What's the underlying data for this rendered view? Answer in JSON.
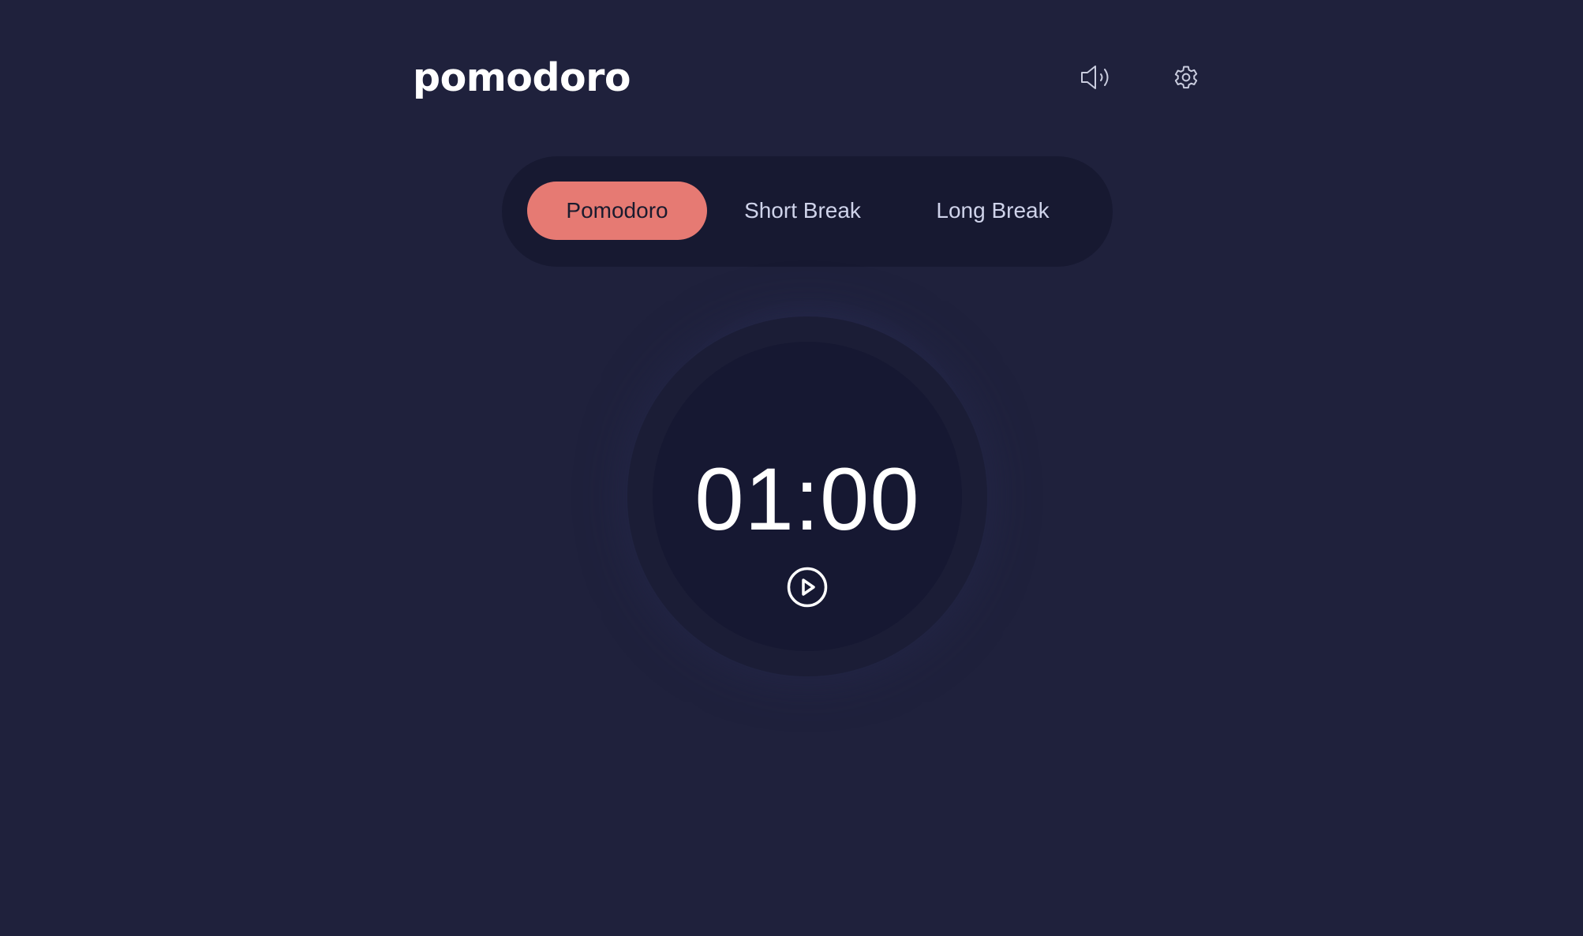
{
  "app": {
    "brand": "pomodoro"
  },
  "header": {
    "sound_icon": "speaker-volume-icon",
    "settings_icon": "gear-icon"
  },
  "tabs": [
    {
      "label": "Pomodoro",
      "active": true
    },
    {
      "label": "Short Break",
      "active": false
    },
    {
      "label": "Long Break",
      "active": false
    }
  ],
  "timer": {
    "time": "01:00",
    "control_icon": "play-circle-icon"
  },
  "colors": {
    "background": "#1f213c",
    "panel": "#171931",
    "accent": "#e67a73",
    "text": "#ffffff",
    "muted_text": "#cfd3ea"
  }
}
